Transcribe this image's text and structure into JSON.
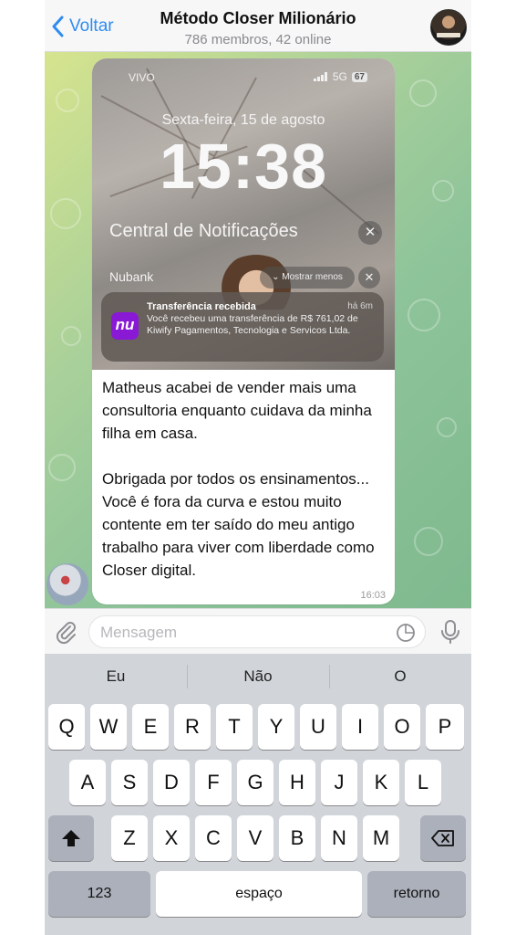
{
  "header": {
    "back_label": "Voltar",
    "title": "Método Closer Milionário",
    "subtitle": "786 membros, 42 online"
  },
  "message": {
    "screenshot": {
      "carrier": "VIVO",
      "network": "5G",
      "battery": "67",
      "date": "Sexta-feira, 15 de agosto",
      "time": "15:38",
      "notification_center": "Central de Notificações",
      "app_name": "Nubank",
      "show_less": "Mostrar menos",
      "notification": {
        "logo_text": "nu",
        "title": "Transferência recebida",
        "time": "há 6m",
        "body": "Você recebeu uma transferência de R$ 761,02 de Kiwify Pagamentos, Tecnologia e Servicos Ltda."
      }
    },
    "text": "Matheus acabei de vender mais uma consultoria enquanto cuidava da minha filha em casa.\n\nObrigada por todos os ensinamentos... Você é fora da curva e estou muito contente em ter saído do meu antigo trabalho para viver com liberdade como Closer digital.",
    "timestamp": "16:03"
  },
  "composer": {
    "placeholder": "Mensagem"
  },
  "keyboard": {
    "suggestions": [
      "Eu",
      "Não",
      "O"
    ],
    "row1": [
      "Q",
      "W",
      "E",
      "R",
      "T",
      "Y",
      "U",
      "I",
      "O",
      "P"
    ],
    "row2": [
      "A",
      "S",
      "D",
      "F",
      "G",
      "H",
      "J",
      "K",
      "L"
    ],
    "row3": [
      "Z",
      "X",
      "C",
      "V",
      "B",
      "N",
      "M"
    ],
    "numbers_key": "123",
    "space_key": "espaço",
    "return_key": "retorno"
  },
  "colors": {
    "accent": "#2f8cf0",
    "nubank_purple": "#8a19d6"
  }
}
